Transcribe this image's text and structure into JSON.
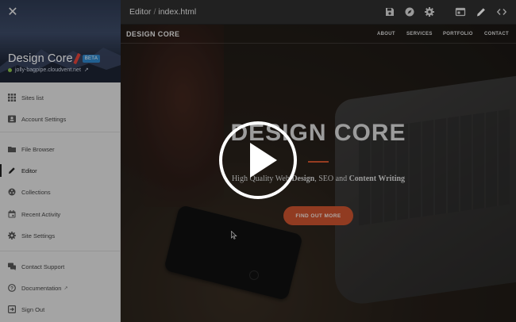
{
  "sidebar": {
    "site_name": "Design Core",
    "badge": "BETA",
    "site_url": "jolly-bagpipe.cloudvent.net",
    "items": [
      {
        "label": "Sites list",
        "icon": "grid-icon"
      },
      {
        "label": "Account Settings",
        "icon": "account-card-icon"
      },
      {
        "label": "File Browser",
        "icon": "folder-icon"
      },
      {
        "label": "Editor",
        "icon": "pencil-icon"
      },
      {
        "label": "Collections",
        "icon": "collections-icon"
      },
      {
        "label": "Recent Activity",
        "icon": "calendar-icon"
      },
      {
        "label": "Site Settings",
        "icon": "gear-icon"
      },
      {
        "label": "Contact Support",
        "icon": "chat-icon"
      },
      {
        "label": "Documentation",
        "icon": "help-icon"
      },
      {
        "label": "Sign Out",
        "icon": "sign-out-icon"
      }
    ],
    "active_item": "Editor"
  },
  "topbar": {
    "section": "Editor",
    "separator": "/",
    "file": "index.html",
    "icons": [
      "save-icon",
      "compass-icon",
      "gear-icon",
      "layout-icon",
      "pencil-icon",
      "code-icon"
    ]
  },
  "preview": {
    "logo": "DESIGN CORE",
    "nav": [
      "ABOUT",
      "SERVICES",
      "PORTFOLIO",
      "CONTACT"
    ],
    "hero_title": "DESIGN CORE",
    "hero_sub_pre": "High Quality Web ",
    "hero_sub_b1": "Design",
    "hero_sub_mid1": ", SEO and ",
    "hero_sub_b2": "Content Writing",
    "cta": "FIND OUT MORE"
  },
  "colors": {
    "accent": "#c9522e",
    "badge": "#2f86c9",
    "status": "#8bc34a"
  },
  "overlay": {
    "icon": "play-icon"
  }
}
